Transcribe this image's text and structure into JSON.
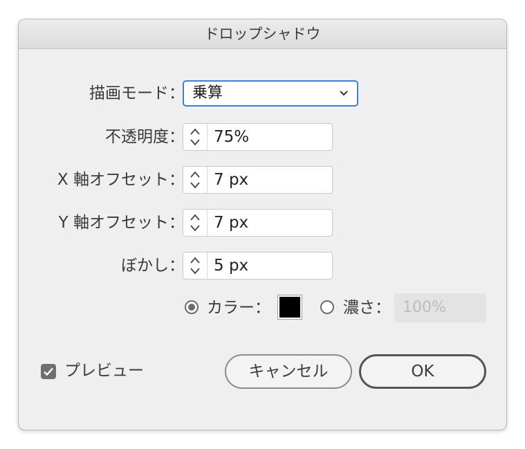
{
  "dialog": {
    "title": "ドロップシャドウ",
    "mode": {
      "label": "描画モード：",
      "value": "乗算"
    },
    "opacity": {
      "label": "不透明度：",
      "value": "75%"
    },
    "x_offset": {
      "label": "X 軸オフセット：",
      "value": "7 px"
    },
    "y_offset": {
      "label": "Y 軸オフセット：",
      "value": "7 px"
    },
    "blur": {
      "label": "ぼかし：",
      "value": "5 px"
    },
    "color_option": {
      "label": "カラー：",
      "selected": true,
      "swatch": "#000000"
    },
    "darkness_option": {
      "label": "濃さ：",
      "selected": false,
      "value": "100%"
    },
    "preview": {
      "label": "プレビュー",
      "checked": true
    },
    "buttons": {
      "cancel": "キャンセル",
      "ok": "OK"
    }
  }
}
